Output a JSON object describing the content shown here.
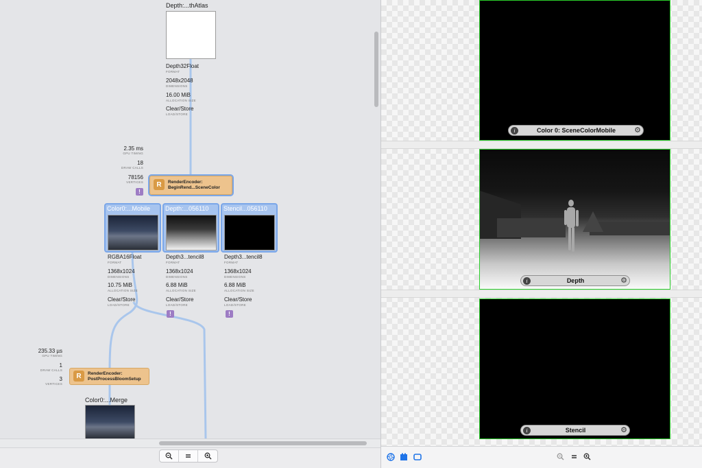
{
  "graph": {
    "nodes": {
      "shadow": {
        "title": "Depth:...thAtlas",
        "format": "Depth32Float",
        "format_key": "FORMAT",
        "dims": "2048x2048",
        "dims_key": "DIMENSIONS",
        "alloc": "16.00 MiB",
        "alloc_key": "ALLOCATION SIZE",
        "load": "Clear/Store",
        "load_key": "LOAD/STORE"
      },
      "color0": {
        "title": "Color0:...Mobile",
        "format": "RGBA16Float",
        "format_key": "FORMAT",
        "dims": "1368x1024",
        "dims_key": "DIMENSIONS",
        "alloc": "10.75 MiB",
        "alloc_key": "ALLOCATION SIZE",
        "load": "Clear/Store",
        "load_key": "LOAD/STORE"
      },
      "depth": {
        "title": "Depth:...056110",
        "format": "Depth3...tencil8",
        "format_key": "FORMAT",
        "dims": "1368x1024",
        "dims_key": "DIMENSIONS",
        "alloc": "6.88 MiB",
        "alloc_key": "ALLOCATION SIZE",
        "load": "Clear/Store",
        "load_key": "LOAD/STORE"
      },
      "stencil": {
        "title": "Stencil...056110",
        "format": "Depth3...tencil8",
        "format_key": "FORMAT",
        "dims": "1368x1024",
        "dims_key": "DIMENSIONS",
        "alloc": "6.88 MiB",
        "alloc_key": "ALLOCATION SIZE",
        "load": "Clear/Store",
        "load_key": "LOAD/STORE"
      },
      "merge": {
        "title": "Color0:...Merge"
      }
    },
    "encoders": {
      "scene": {
        "badge": "R",
        "line1": "RenderEncoder:",
        "line2": "BeginRend...SceneColor",
        "timing": "2.35 ms",
        "timing_key": "GPU TIMING",
        "draws": "18",
        "draws_key": "DRAW CALLS",
        "verts": "78156",
        "verts_key": "VERTICES"
      },
      "bloom": {
        "badge": "R",
        "line1": "RenderEncoder:",
        "line2": "PostProcessBloomSetup",
        "timing": "235.33 µs",
        "timing_key": "GPU TIMING",
        "draws": "1",
        "draws_key": "DRAW CALLS",
        "verts": "3",
        "verts_key": "VERTICES"
      }
    },
    "warning_glyph": "!",
    "zoom": {
      "out": "zoom-out-icon",
      "fit": "zoom-fit-icon",
      "in": "zoom-in-icon"
    }
  },
  "viewer": {
    "attachments": [
      {
        "label": "Color 0: SceneColorMobile"
      },
      {
        "label": "Depth"
      },
      {
        "label": "Stencil"
      }
    ],
    "info_glyph": "i",
    "gear_glyph": "⚙",
    "toolbar": {
      "left_icons": [
        "aperture-icon",
        "film-strip-icon",
        "frame-icon"
      ],
      "zoom": [
        "zoom-out-icon",
        "zoom-fit-icon",
        "zoom-in-icon"
      ]
    }
  },
  "colors": {
    "selection": "#7aa6e8",
    "encoder": "#edc38d",
    "warning": "#9d7cc4",
    "attachment_border": "#2bd02b",
    "edge": "#a9c6ec"
  }
}
